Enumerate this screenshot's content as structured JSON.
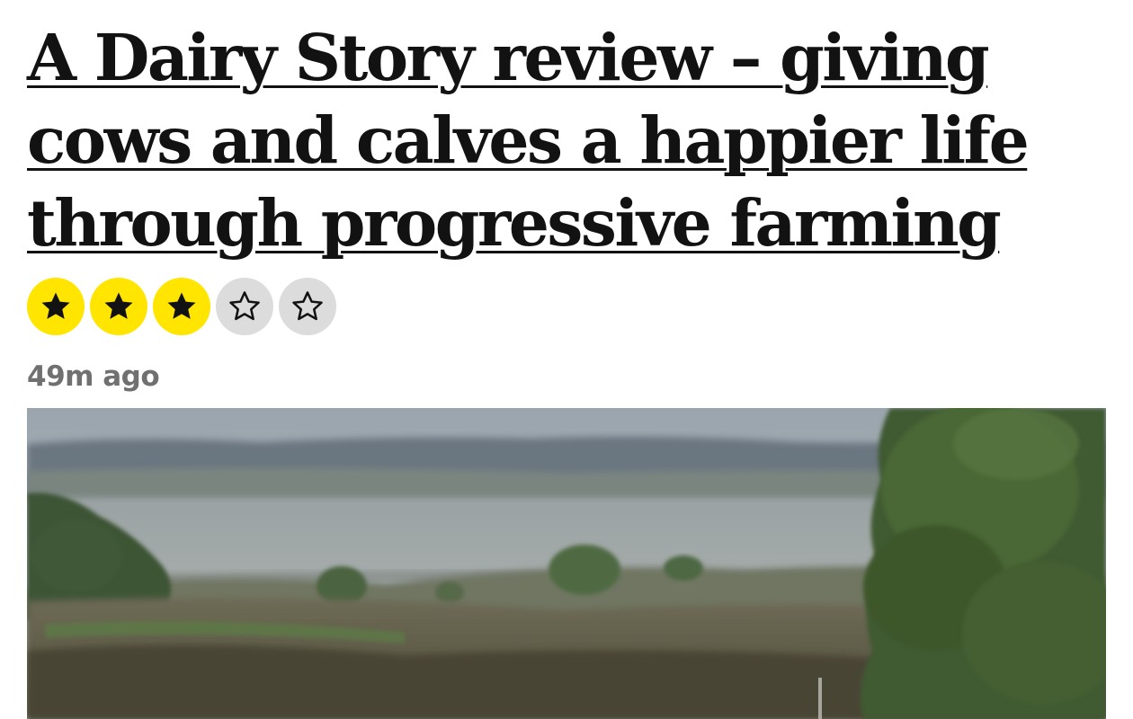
{
  "article": {
    "headline": "A Dairy Story review – giving cows and calves a happier life through progressive farming",
    "rating": {
      "value": 3,
      "max": 5
    },
    "timestamp": "49m ago"
  },
  "colors": {
    "star_filled_bg": "#ffe500",
    "star_empty_bg": "#dcdcdc",
    "headline_text": "#121212",
    "timestamp_text": "#707070"
  },
  "icons": {
    "star_filled": "star-filled-icon",
    "star_empty": "star-outline-icon"
  }
}
